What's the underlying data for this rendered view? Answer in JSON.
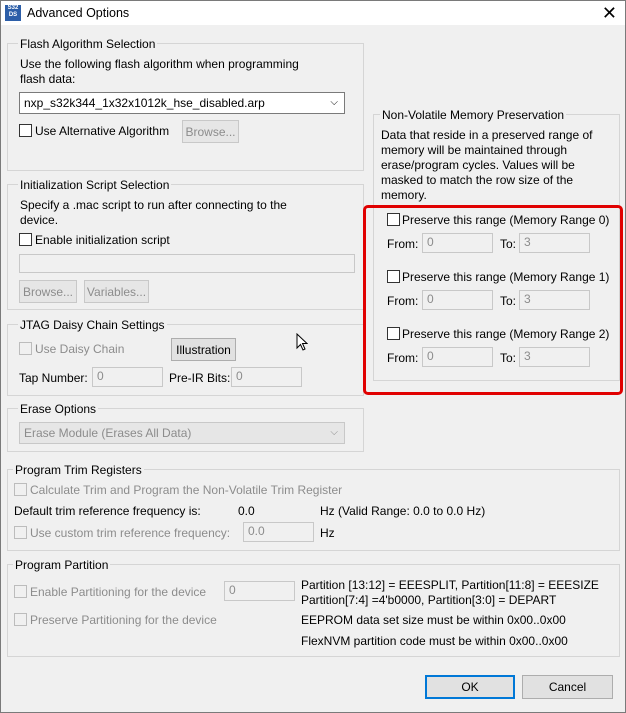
{
  "window": {
    "title": "Advanced Options",
    "icon_text": "S32 DS"
  },
  "flash": {
    "legend": "Flash Algorithm Selection",
    "desc1": "Use the following flash algorithm when programming",
    "desc2": "flash data:",
    "selected": "nxp_s32k344_1x32x1012k_hse_disabled.arp",
    "alt_label": "Use Alternative Algorithm",
    "browse": "Browse..."
  },
  "init": {
    "legend": "Initialization Script Selection",
    "desc1": "Specify a .mac script to run after connecting to the",
    "desc2": "device.",
    "enable_label": "Enable initialization script",
    "path_value": "",
    "browse": "Browse...",
    "variables": "Variables..."
  },
  "jtag": {
    "legend": "JTAG Daisy Chain Settings",
    "use_label": "Use Daisy Chain",
    "illustration": "Illustration",
    "tap_label": "Tap Number:",
    "tap_value": "0",
    "preir_label": "Pre-IR Bits:",
    "preir_value": "0"
  },
  "erase": {
    "legend": "Erase Options",
    "selected": "Erase Module (Erases All Data)"
  },
  "nvm": {
    "legend": "Non-Volatile Memory Preservation",
    "desc": [
      "Data that reside in a preserved range of",
      "memory will be maintained through",
      "erase/program cycles. Values will be",
      "masked to match the row size of the",
      "memory."
    ],
    "ranges": [
      {
        "label": "Preserve this range (Memory Range 0)",
        "from_label": "From:",
        "from": "0",
        "to_label": "To:",
        "to": "3"
      },
      {
        "label": "Preserve this range (Memory Range 1)",
        "from_label": "From:",
        "from": "0",
        "to_label": "To:",
        "to": "3"
      },
      {
        "label": "Preserve this range (Memory Range 2)",
        "from_label": "From:",
        "from": "0",
        "to_label": "To:",
        "to": "3"
      }
    ]
  },
  "trim": {
    "legend": "Program Trim Registers",
    "calc_label": "Calculate Trim and Program the Non-Volatile Trim Register",
    "default_label": "Default trim reference frequency is:",
    "default_value": "0.0",
    "range_text": "Hz (Valid Range: 0.0 to 0.0 Hz)",
    "custom_label": "Use custom trim reference frequency:",
    "custom_value": "0.0",
    "custom_unit": "Hz"
  },
  "partition": {
    "legend": "Program Partition",
    "enable_label": "Enable Partitioning for the device",
    "enable_value": "0",
    "preserve_label": "Preserve Partitioning for the device",
    "info1": "Partition [13:12] = EEESPLIT, Partition[11:8] = EEESIZE",
    "info2": "Partition[7:4] =4'b0000, Partition[3:0] = DEPART",
    "info3": "EEPROM data set size must be within 0x00..0x00",
    "info4": "FlexNVM partition code must be within 0x00..0x00"
  },
  "buttons": {
    "ok": "OK",
    "cancel": "Cancel"
  }
}
